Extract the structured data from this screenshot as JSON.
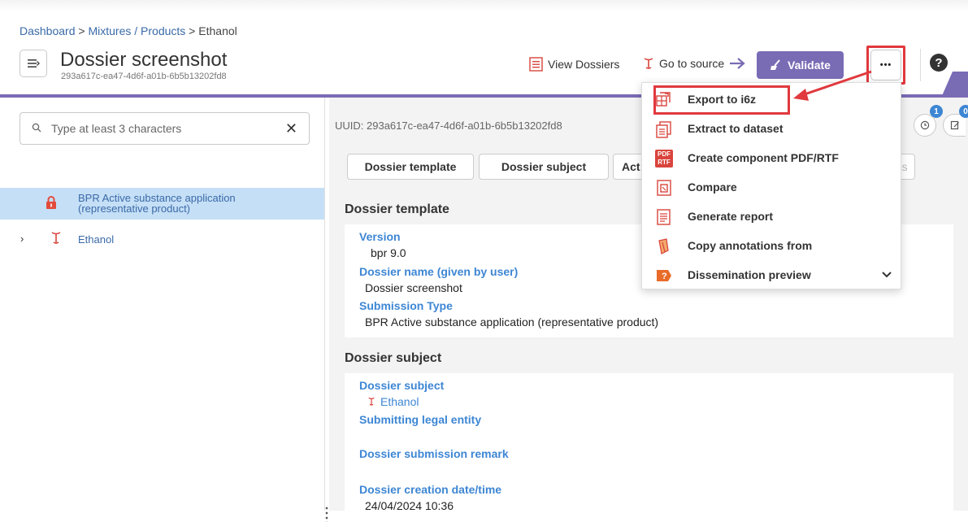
{
  "breadcrumb": {
    "items": [
      "Dashboard",
      "Mixtures / Products",
      "Ethanol"
    ],
    "sep1": " > ",
    "sep2": " > "
  },
  "header": {
    "title": "Dossier screenshot",
    "uuid": "293a617c-ea47-4d6f-a01b-6b5b13202fd8",
    "view_dossiers": "View Dossiers",
    "go_to_source": "Go to source",
    "validate": "Validate",
    "more": "•••",
    "help": "?"
  },
  "search": {
    "placeholder": "Type at least 3 characters"
  },
  "tree": {
    "selected_label_line1": "BPR Active substance application",
    "selected_label_line2": "(representative product)",
    "item_label": "Ethanol"
  },
  "main": {
    "uuid_label": "UUID: 293a617c-ea47-4d6f-a01b-6b5b13202fd8",
    "tabs": [
      "Dossier template",
      "Dossier subject",
      "Act",
      "s"
    ],
    "badges": [
      "1",
      "0"
    ],
    "section1": {
      "title": "Dossier template",
      "fields": [
        {
          "label": "Version",
          "value": "bpr 9.0"
        },
        {
          "label": "Dossier name (given by user)",
          "value": "Dossier screenshot"
        },
        {
          "label": "Submission Type",
          "value": "BPR Active substance application (representative product)"
        }
      ]
    },
    "section2": {
      "title": "Dossier subject",
      "fields": [
        {
          "label": "Dossier subject",
          "value": "Ethanol"
        },
        {
          "label": "Submitting legal entity",
          "value": ""
        },
        {
          "label": "Dossier submission remark",
          "value": ""
        },
        {
          "label": "Dossier creation date/time",
          "value": "24/04/2024 10:36"
        }
      ]
    }
  },
  "dropdown": {
    "items": [
      {
        "label": "Export to i6z",
        "icon": "export-icon"
      },
      {
        "label": "Extract to dataset",
        "icon": "dataset-icon"
      },
      {
        "label": "Create component PDF/RTF",
        "icon": "pdf-rtf-icon"
      },
      {
        "label": "Compare",
        "icon": "compare-icon"
      },
      {
        "label": "Generate report",
        "icon": "report-icon"
      },
      {
        "label": "Copy annotations from",
        "icon": "annotations-icon"
      },
      {
        "label": "Dissemination preview",
        "icon": "dissemination-icon"
      }
    ],
    "pdf_icon_top": "PDF",
    "pdf_icon_bottom": "RTF"
  },
  "colors": {
    "accent": "#7a6bb5",
    "link": "#3d86d4",
    "highlight": "#e0393e",
    "selection": "#c5dff6"
  }
}
